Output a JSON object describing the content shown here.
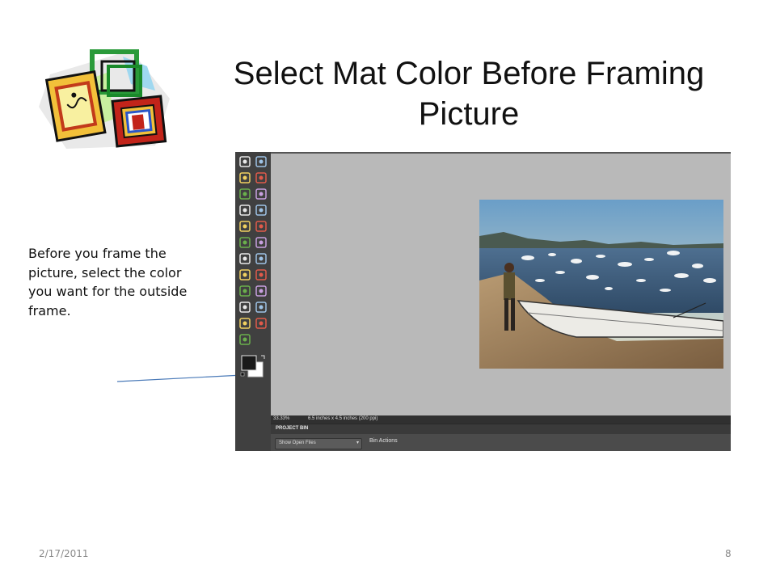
{
  "slide": {
    "title": "Select Mat Color Before Framing Picture",
    "body": "Before you frame the picture, select the color you want for the outside frame.",
    "date": "2/17/2011",
    "page_number": "8"
  },
  "clipart": {
    "icon": "picture-frames-clipart-icon"
  },
  "editor": {
    "status_zoom": "33.33%",
    "status_doc": "6.5 inches x 4.5 inches (200 ppi)",
    "panel_title": "PROJECT BIN",
    "bin_dropdown": "Show Open Files",
    "bin_actions": "Bin Actions",
    "tools": [
      "move-tool-icon",
      "zoom-tool-icon",
      "hand-tool-icon",
      "eyedropper-tool-icon",
      "marquee-tool-icon",
      "lasso-tool-icon",
      "magic-wand-tool-icon",
      "selection-brush-tool-icon",
      "type-tool-icon",
      "crop-tool-icon",
      "cookie-cutter-tool-icon",
      "recompose-tool-icon",
      "red-eye-tool-icon",
      "spot-healing-tool-icon",
      "clone-stamp-tool-icon",
      "eraser-tool-icon",
      "brush-tool-icon",
      "smart-brush-tool-icon",
      "paint-bucket-tool-icon",
      "gradient-tool-icon",
      "shape-tool-icon",
      "blur-tool-icon",
      "sponge-tool-icon"
    ],
    "colors": {
      "canvas": "#b9b9b9",
      "foreground": "#1a1a1a",
      "background": "#ffffff"
    }
  }
}
